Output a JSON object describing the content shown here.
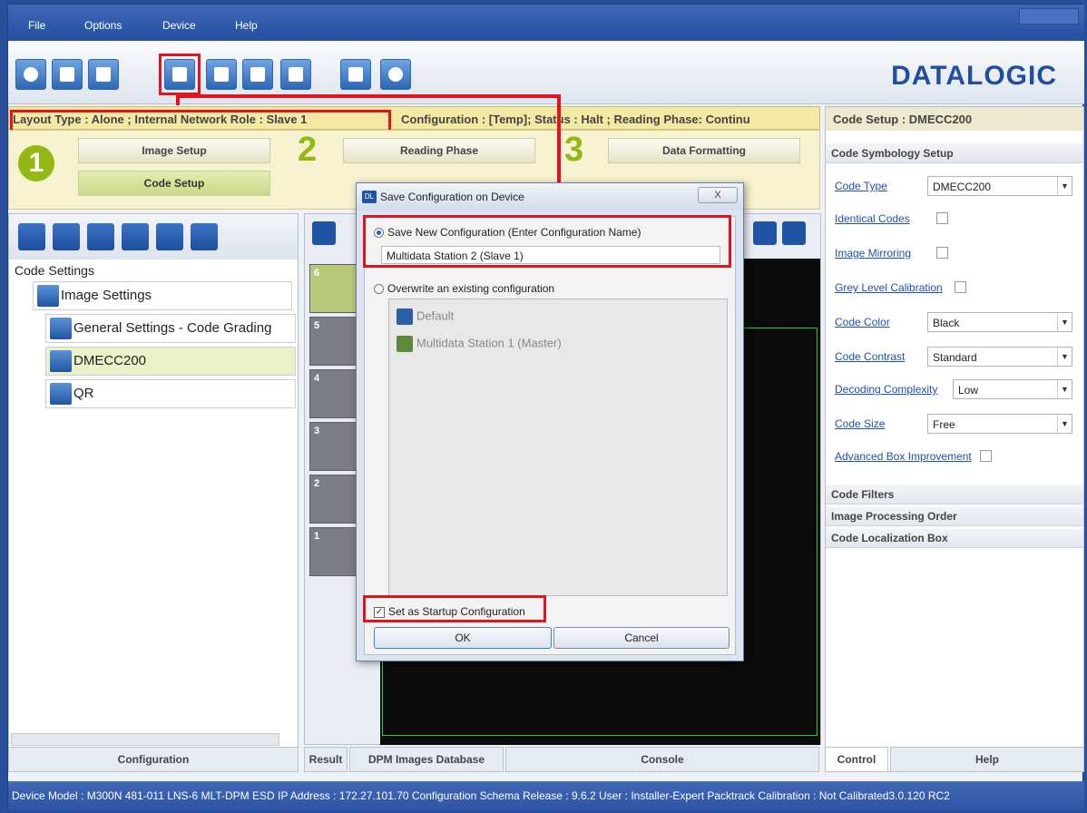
{
  "menu": {
    "items": [
      "File",
      "Options",
      "Device",
      "Help"
    ]
  },
  "logo": {
    "text": "DATALOGIC"
  },
  "status": {
    "layout": "Layout Type : Alone ; Internal Network Role : Slave 1",
    "config": "Configuration : [Temp]; Status : Halt ; Reading Phase: Continu"
  },
  "steps": {
    "step1": "1",
    "step2": "2",
    "step3": "3",
    "image_setup": "Image Setup",
    "code_setup": "Code Setup",
    "reading_phase": "Reading Phase",
    "data_formatting": "Data Formatting"
  },
  "tree": {
    "root": "Code Settings",
    "image_settings": "Image Settings",
    "general_settings": "General Settings - Code Grading",
    "dmecc": "DMECC200",
    "qr": "QR"
  },
  "left_tabs": {
    "configuration": "Configuration"
  },
  "mid_tabs": {
    "result": "Result",
    "dpm": "DPM Images Database",
    "console": "Console"
  },
  "thumbs": [
    "6",
    "5",
    "4",
    "3",
    "2",
    "1"
  ],
  "right": {
    "header": "Code Setup : DMECC200",
    "symbology_section": "Code Symbology Setup",
    "code_type_label": "Code Type",
    "code_type_value": "DMECC200",
    "identical_codes": "Identical Codes",
    "image_mirroring": "Image Mirroring",
    "grey_level": "Grey Level Calibration",
    "code_color_label": "Code Color",
    "code_color_value": "Black",
    "code_contrast_label": "Code Contrast",
    "code_contrast_value": "Standard",
    "decoding_label": "Decoding Complexity",
    "decoding_value": "Low",
    "code_size_label": "Code Size",
    "code_size_value": "Free",
    "advanced_box": "Advanced Box Improvement",
    "code_filters": "Code Filters",
    "processing_order": "Image Processing Order",
    "localization_box": "Code Localization Box",
    "tab_control": "Control",
    "tab_help": "Help"
  },
  "dialog": {
    "title": "Save Configuration on Device",
    "close": "X",
    "save_new": "Save New Configuration (Enter Configuration Name)",
    "config_name": "Multidata Station 2 (Slave 1)",
    "overwrite": "Overwrite an existing configuration",
    "existing": [
      "Default",
      "Multidata Station 1 (Master)"
    ],
    "startup": "Set as Startup Configuration",
    "ok": "OK",
    "cancel": "Cancel"
  },
  "bottom": {
    "text": "Device Model : M300N 481-011 LNS-6 MLT-DPM ESD   IP Address :  172.27.101.70   Configuration Schema Release :  9.6.2   User : Installer-Expert   Packtrack Calibration : Not Calibrated3.0.120 RC2"
  },
  "colors": {
    "accent": "#2a4f9a",
    "highlight": "#e0131f",
    "step_green": "#92b814"
  }
}
